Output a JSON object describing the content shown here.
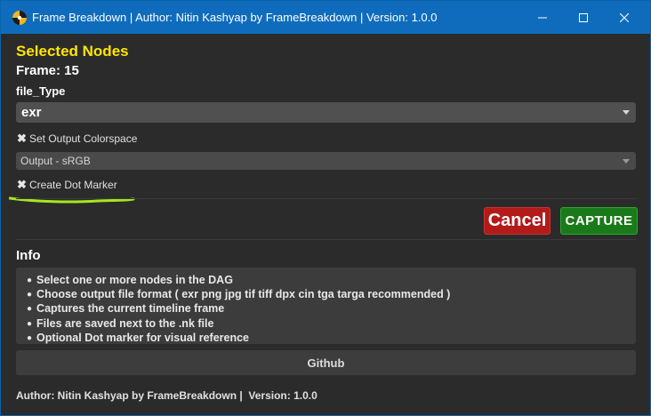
{
  "window": {
    "title": "Frame Breakdown | Author: Nitin Kashyap by FrameBreakdown |  Version: 1.0.0",
    "minimize_glyph": "—",
    "maximize_glyph": "☐",
    "close_glyph": "✕"
  },
  "main": {
    "heading": "Selected Nodes",
    "frame_label": "Frame: 15",
    "file_type_label": "file_Type",
    "file_type_value": "exr",
    "set_output_colorspace_label": "Set Output Colorspace",
    "set_output_colorspace_checked": true,
    "colorspace_value": "Output - sRGB",
    "create_dot_marker_label": "Create Dot Marker",
    "create_dot_marker_checked": true,
    "check_glyph": "✖"
  },
  "actions": {
    "cancel_label": "Cancel",
    "capture_label": "CAPTURE"
  },
  "info": {
    "title": "Info",
    "items": [
      "Select one or more nodes in the DAG",
      "Choose output file format ( exr png jpg tif tiff dpx cin tga targa recommended )",
      "Captures the current timeline frame",
      "Files are saved next to the .nk file",
      "Optional Dot marker for visual reference"
    ],
    "github_label": "Github"
  },
  "footer": {
    "text": "Author: Nitin Kashyap by FrameBreakdown |  Version: 1.0.0"
  },
  "colors": {
    "title_bar": "#0f6cbd",
    "heading": "#ffe600",
    "cancel": "#b31a1a",
    "capture": "#1a7a1a",
    "annotation_underline": "#a6e81a"
  },
  "icons": {
    "app": "frame-breakdown-app-icon"
  }
}
